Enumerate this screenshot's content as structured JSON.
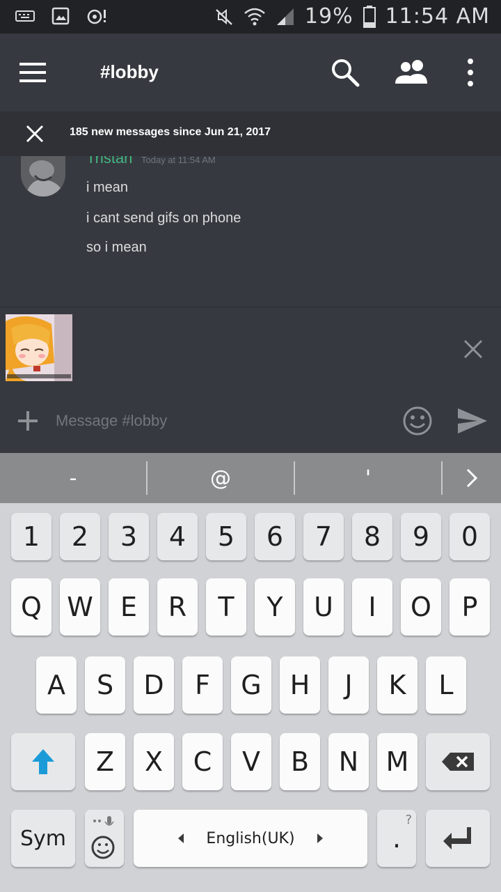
{
  "status_bar": {
    "battery_text": "19%",
    "time": "11:54 AM"
  },
  "header": {
    "channel_title": "#lobby"
  },
  "banner": {
    "text": "185 new messages since Jun 21, 2017"
  },
  "message_group": {
    "author": "Tristan",
    "author_color": "#43b581",
    "timestamp": "Today at 11:54 AM",
    "lines": [
      "i mean",
      "i cant send gifs on phone",
      "so i mean"
    ]
  },
  "composer": {
    "placeholder": "Message #lobby"
  },
  "keyboard": {
    "suggestions": [
      "-",
      "@",
      "'"
    ],
    "number_row": [
      "1",
      "2",
      "3",
      "4",
      "5",
      "6",
      "7",
      "8",
      "9",
      "0"
    ],
    "row1": [
      "Q",
      "W",
      "E",
      "R",
      "T",
      "Y",
      "U",
      "I",
      "O",
      "P"
    ],
    "row2": [
      "A",
      "S",
      "D",
      "F",
      "G",
      "H",
      "J",
      "K",
      "L"
    ],
    "row3": [
      "Z",
      "X",
      "C",
      "V",
      "B",
      "N",
      "M"
    ],
    "sym_label": "Sym",
    "space_label": "English(UK)",
    "period_label": ".",
    "period_hint": "?"
  },
  "colors": {
    "background": "#36393f",
    "header": "#36393f",
    "banner": "#2f3136",
    "shift_arrow": "#1a9bd7"
  }
}
